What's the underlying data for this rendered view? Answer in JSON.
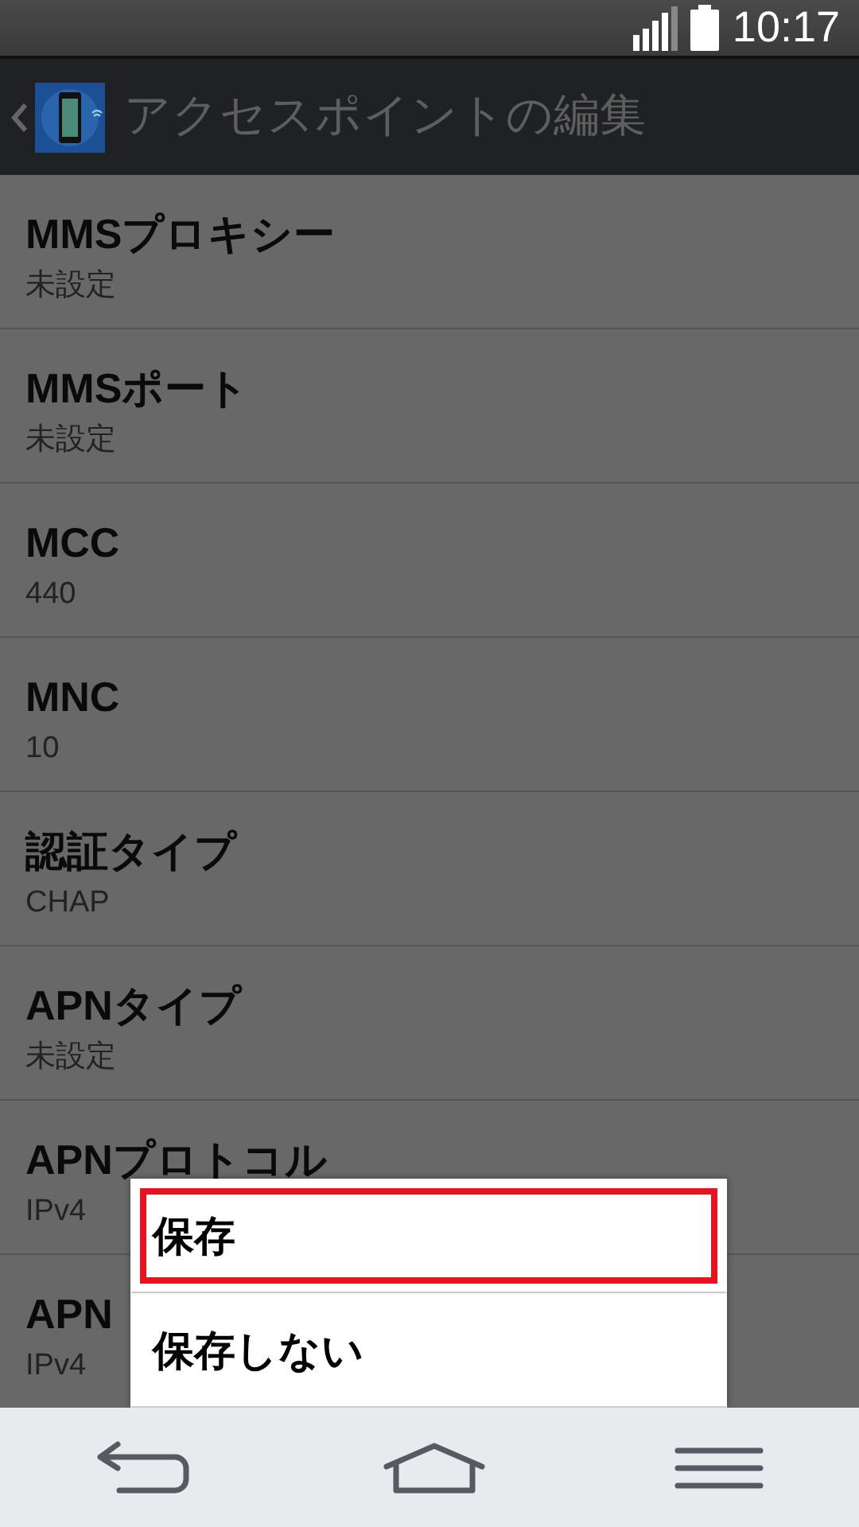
{
  "status_bar": {
    "time": "10:17"
  },
  "header": {
    "title": "アクセスポイントの編集"
  },
  "settings": [
    {
      "title": "MMSプロキシー",
      "value": "未設定"
    },
    {
      "title": "MMSポート",
      "value": "未設定"
    },
    {
      "title": "MCC",
      "value": "440"
    },
    {
      "title": "MNC",
      "value": "10"
    },
    {
      "title": "認証タイプ",
      "value": "CHAP"
    },
    {
      "title": "APNタイプ",
      "value": "未設定"
    },
    {
      "title": "APNプロトコル",
      "value": "IPv4"
    },
    {
      "title": "APN",
      "value": "IPv4"
    }
  ],
  "menu": [
    {
      "label": "保存",
      "highlighted": true
    },
    {
      "label": "保存しない",
      "highlighted": false
    }
  ]
}
